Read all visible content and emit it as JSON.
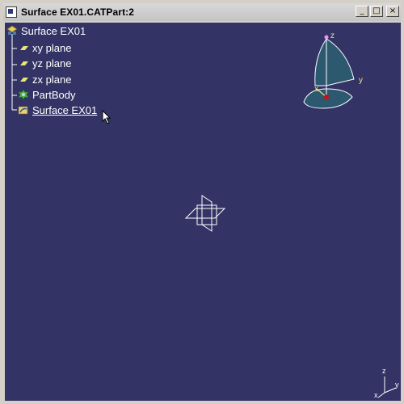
{
  "window": {
    "title": "Surface EX01.CATPart:2",
    "controls": {
      "minimize": "_",
      "maximize": "□",
      "close": "×"
    }
  },
  "tree": {
    "root": "Surface EX01",
    "items": [
      {
        "label": "xy plane",
        "icon": "plane-icon"
      },
      {
        "label": "yz plane",
        "icon": "plane-icon"
      },
      {
        "label": "zx plane",
        "icon": "plane-icon"
      },
      {
        "label": "PartBody",
        "icon": "partbody-icon"
      },
      {
        "label": "Surface EX01",
        "icon": "geometrical-set-icon"
      }
    ]
  },
  "compass": {
    "axis_z": "z",
    "axis_y": "y",
    "axis_x": "x"
  },
  "mini_axis": {
    "z": "z",
    "y": "y",
    "x": "x"
  },
  "colors": {
    "background": "#333366",
    "tree_text": "#ffffff",
    "plane_icon": "#e8e870",
    "compass_fill": "#2c5870"
  }
}
